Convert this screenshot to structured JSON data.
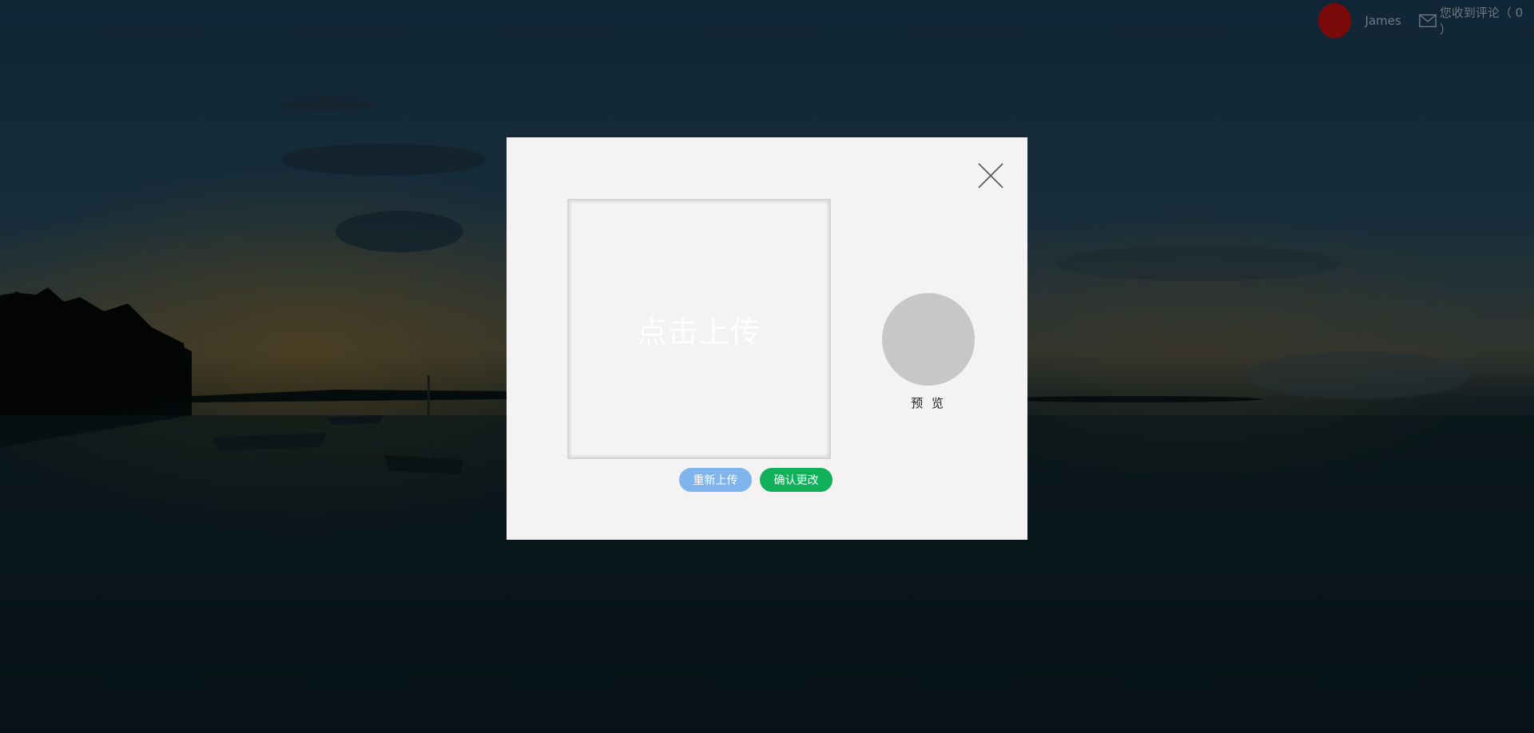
{
  "header": {
    "username": "James",
    "comments_label": "您收到评论（ 0 ）",
    "avatar_color": "#7a0a0a"
  },
  "modal": {
    "upload_label": "点击上传",
    "preview_label": "预 览",
    "reupload_button": "重新上传",
    "confirm_button": "确认更改",
    "close_icon": "close-icon",
    "colors": {
      "reupload": "#7fb5ec",
      "confirm": "#10b15a",
      "preview_circle": "#c7c7c7",
      "panel": "#f4f2f3"
    }
  }
}
